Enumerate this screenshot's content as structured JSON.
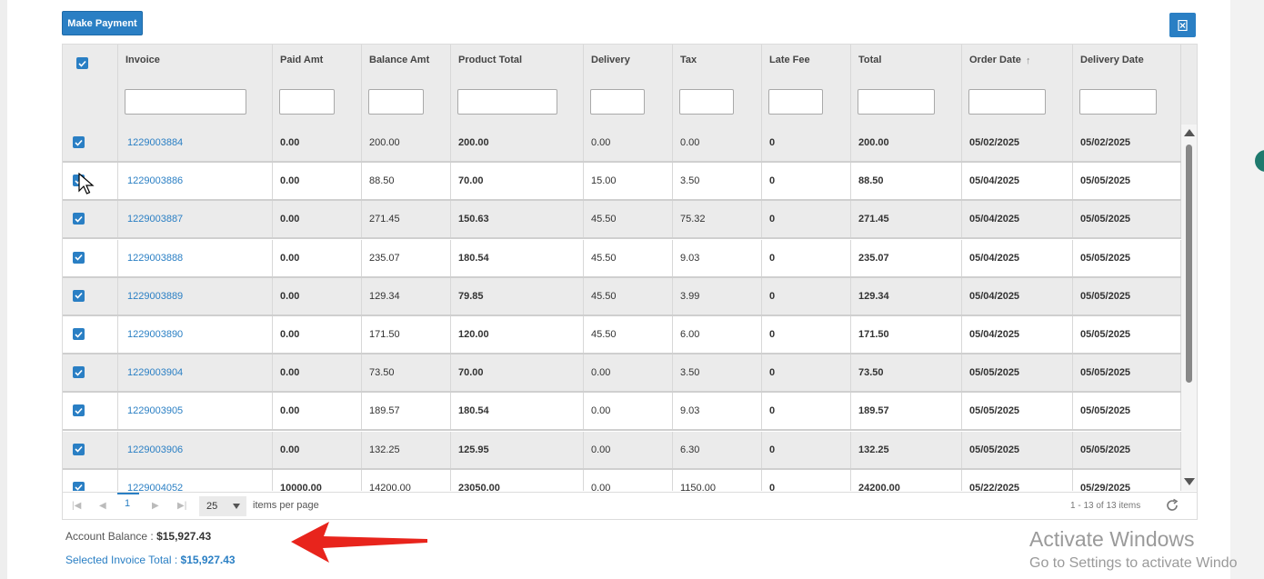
{
  "toolbar": {
    "make_payment_label": "Make Payment",
    "export_icon": "excel-export-icon"
  },
  "grid": {
    "columns": [
      {
        "label": "Invoice"
      },
      {
        "label": "Paid Amt"
      },
      {
        "label": "Balance Amt"
      },
      {
        "label": "Product Total"
      },
      {
        "label": "Delivery"
      },
      {
        "label": "Tax"
      },
      {
        "label": "Late Fee"
      },
      {
        "label": "Total"
      },
      {
        "label": "Order Date",
        "sort": "↑"
      },
      {
        "label": "Delivery Date"
      }
    ],
    "rows": [
      {
        "invoice": "1229003884",
        "paid": "0.00",
        "balance": "200.00",
        "product_total": "200.00",
        "delivery": "0.00",
        "tax": "0.00",
        "late_fee": "0",
        "total": "200.00",
        "order_date": "05/02/2025",
        "delivery_date": "05/02/2025",
        "checked": true
      },
      {
        "invoice": "1229003886",
        "paid": "0.00",
        "balance": "88.50",
        "product_total": "70.00",
        "delivery": "15.00",
        "tax": "3.50",
        "late_fee": "0",
        "total": "88.50",
        "order_date": "05/04/2025",
        "delivery_date": "05/05/2025",
        "checked": true
      },
      {
        "invoice": "1229003887",
        "paid": "0.00",
        "balance": "271.45",
        "product_total": "150.63",
        "delivery": "45.50",
        "tax": "75.32",
        "late_fee": "0",
        "total": "271.45",
        "order_date": "05/04/2025",
        "delivery_date": "05/05/2025",
        "checked": true
      },
      {
        "invoice": "1229003888",
        "paid": "0.00",
        "balance": "235.07",
        "product_total": "180.54",
        "delivery": "45.50",
        "tax": "9.03",
        "late_fee": "0",
        "total": "235.07",
        "order_date": "05/04/2025",
        "delivery_date": "05/05/2025",
        "checked": true
      },
      {
        "invoice": "1229003889",
        "paid": "0.00",
        "balance": "129.34",
        "product_total": "79.85",
        "delivery": "45.50",
        "tax": "3.99",
        "late_fee": "0",
        "total": "129.34",
        "order_date": "05/04/2025",
        "delivery_date": "05/05/2025",
        "checked": true
      },
      {
        "invoice": "1229003890",
        "paid": "0.00",
        "balance": "171.50",
        "product_total": "120.00",
        "delivery": "45.50",
        "tax": "6.00",
        "late_fee": "0",
        "total": "171.50",
        "order_date": "05/04/2025",
        "delivery_date": "05/05/2025",
        "checked": true
      },
      {
        "invoice": "1229003904",
        "paid": "0.00",
        "balance": "73.50",
        "product_total": "70.00",
        "delivery": "0.00",
        "tax": "3.50",
        "late_fee": "0",
        "total": "73.50",
        "order_date": "05/05/2025",
        "delivery_date": "05/05/2025",
        "checked": true
      },
      {
        "invoice": "1229003905",
        "paid": "0.00",
        "balance": "189.57",
        "product_total": "180.54",
        "delivery": "0.00",
        "tax": "9.03",
        "late_fee": "0",
        "total": "189.57",
        "order_date": "05/05/2025",
        "delivery_date": "05/05/2025",
        "checked": true
      },
      {
        "invoice": "1229003906",
        "paid": "0.00",
        "balance": "132.25",
        "product_total": "125.95",
        "delivery": "0.00",
        "tax": "6.30",
        "late_fee": "0",
        "total": "132.25",
        "order_date": "05/05/2025",
        "delivery_date": "05/05/2025",
        "checked": true
      },
      {
        "invoice": "1229004052",
        "paid": "10000.00",
        "balance": "14200.00",
        "product_total": "23050.00",
        "delivery": "0.00",
        "tax": "1150.00",
        "late_fee": "0",
        "total": "24200.00",
        "order_date": "05/22/2025",
        "delivery_date": "05/29/2025",
        "checked": true
      }
    ]
  },
  "pager": {
    "current_page": "1",
    "page_size": "25",
    "items_per_page_label": "items per page",
    "items_count": "1 - 13 of 13 items"
  },
  "footer": {
    "account_balance_label": "Account Balance :",
    "account_balance_value": "$15,927.43",
    "selected_total_label": "Selected Invoice Total :",
    "selected_total_value": "$15,927.43"
  },
  "overlay": {
    "watermark_title": "Activate Windows",
    "watermark_subtitle": "Go to Settings to activate Windo"
  },
  "colors": {
    "accent": "#2a7fc4",
    "arrow": "#e8241c"
  }
}
